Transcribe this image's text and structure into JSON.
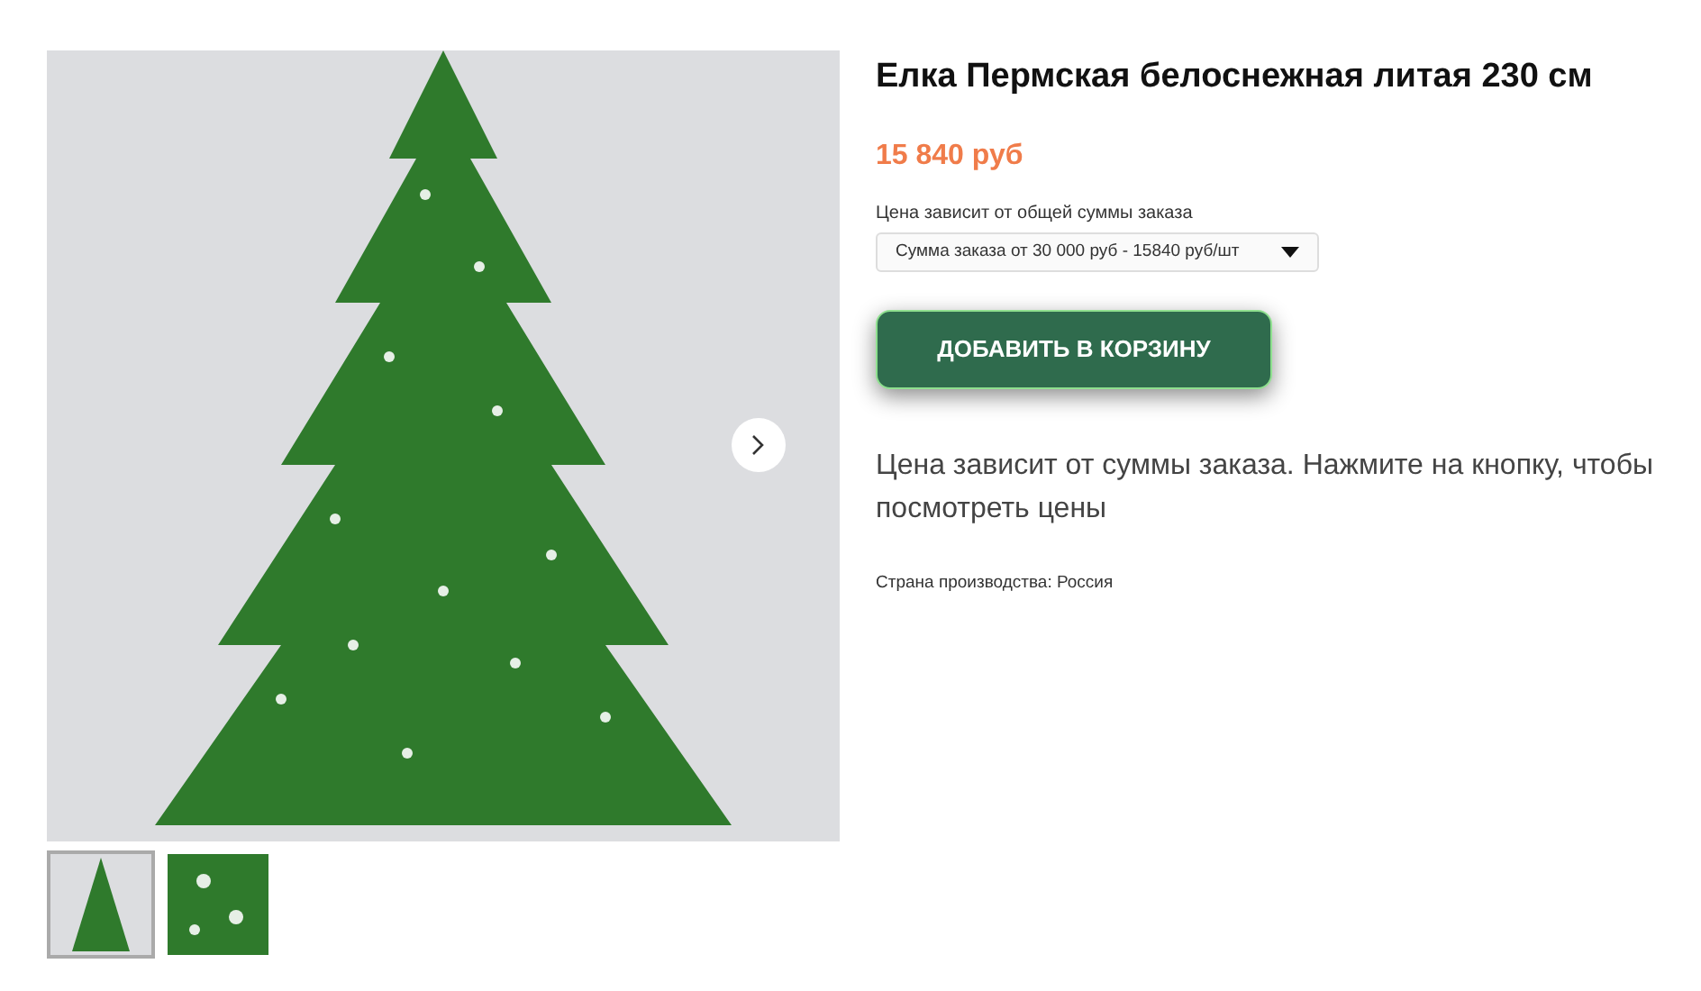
{
  "gallery": {
    "thumbnails": [
      {
        "kind": "tree",
        "selected": true
      },
      {
        "kind": "branch",
        "selected": false
      }
    ]
  },
  "product": {
    "title": "Елка Пермская белоснежная литая 230 см",
    "price": "15 840 руб",
    "price_note": "Цена зависит от общей суммы заказа",
    "price_select": {
      "value": "Сумма заказа от 30 000 руб - 15840 руб/шт"
    },
    "add_to_cart": "ДОБАВИТЬ В КОРЗИНУ",
    "description": "Цена зависит от суммы заказа. Нажмите на кнопку, чтобы посмотреть цены",
    "country": "Страна производства: Россия"
  }
}
